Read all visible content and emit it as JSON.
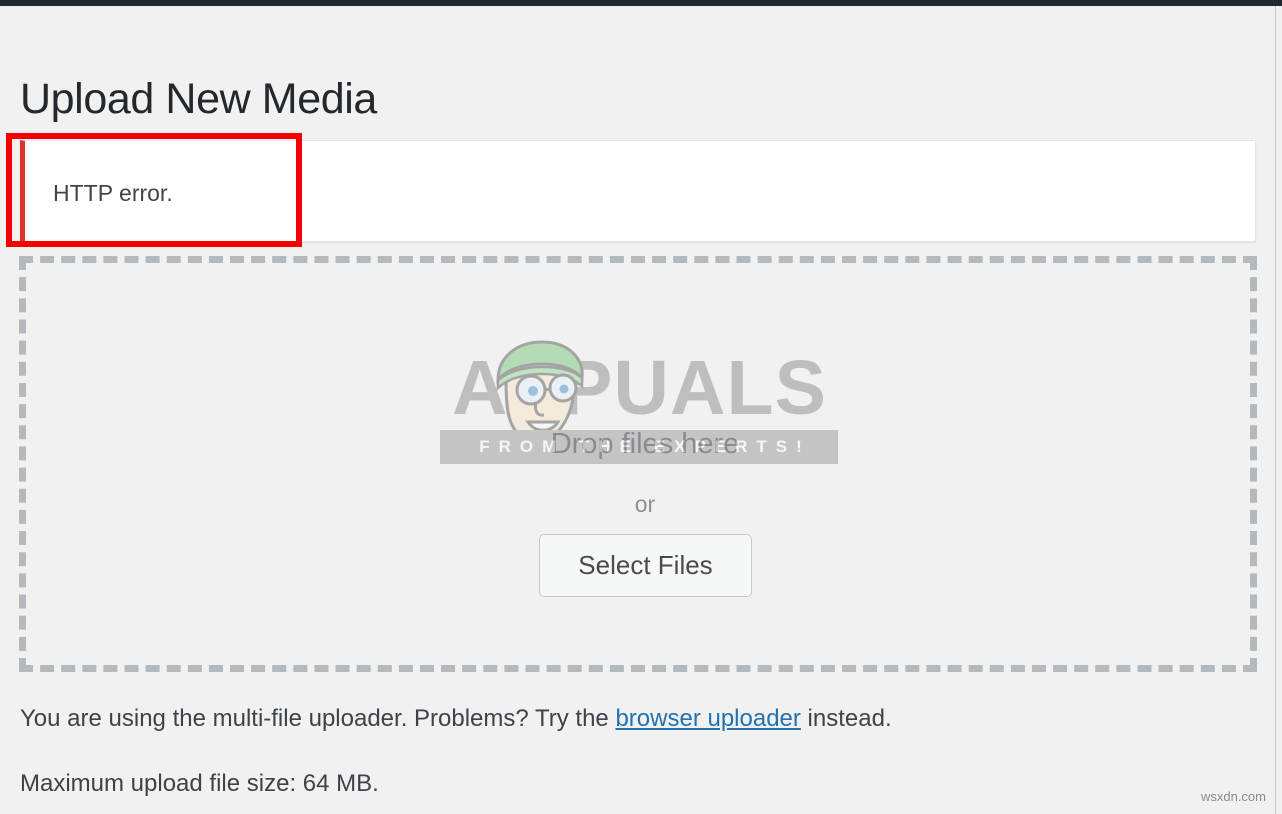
{
  "page": {
    "title": "Upload New Media"
  },
  "notice": {
    "message": "HTTP error.",
    "accent_color": "#dc3232",
    "background": "#ffffff"
  },
  "annotation": {
    "shape": "rectangle",
    "color": "#f40000"
  },
  "dropzone": {
    "drop_text": "Drop files here",
    "or_text": "or",
    "select_button_label": "Select Files",
    "border_color": "#b4b9be"
  },
  "watermark": {
    "brand": "APPUALS",
    "tagline": "FROM THE EXPERTS!",
    "brand_color": "#7a7a7a",
    "tagline_background": "#878787"
  },
  "footer": {
    "uploader_prefix": "You are using the multi-file uploader. Problems? Try the ",
    "uploader_link": "browser uploader",
    "uploader_suffix": " instead.",
    "max_upload": "Maximum upload file size: 64 MB.",
    "link_color": "#2271b1"
  },
  "site_watermark": {
    "text": "wsxdn.com"
  }
}
